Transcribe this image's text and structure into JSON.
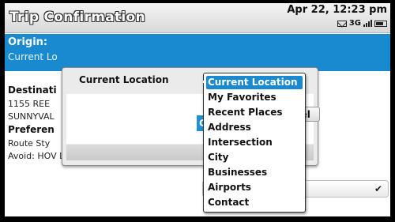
{
  "header": {
    "title": "Trip Confirmation",
    "datetime": "Apr 22, 12:23 pm",
    "network": "3G"
  },
  "origin": {
    "label": "Origin:",
    "value": "Current Lo"
  },
  "fields": [
    {
      "label": "Destinati",
      "lines": [
        "1155 REE",
        "SUNNYVAL"
      ]
    },
    {
      "label": "Preferen",
      "lines": [
        "Route Sty",
        "Avoid: HOV Lanes"
      ]
    }
  ],
  "dialog": {
    "title": "Current Location",
    "select_button": "C",
    "cancel_button": "Cancel"
  },
  "dropdown": {
    "selected": "Current Location",
    "options": [
      "Current Location",
      "My Favorites",
      "Recent Places",
      "Address",
      "Intersection",
      "City",
      "Businesses",
      "Airports",
      "Contact"
    ]
  }
}
